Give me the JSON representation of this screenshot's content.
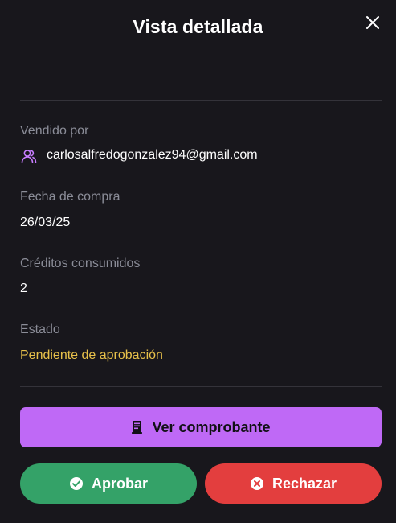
{
  "modal": {
    "title": "Vista detallada",
    "close_icon": "close-icon"
  },
  "details": {
    "seller": {
      "label": "Vendido por",
      "icon": "users-icon",
      "value": "carlosalfredogonzalez94@gmail.com"
    },
    "purchase_date": {
      "label": "Fecha de compra",
      "value": "26/03/25"
    },
    "credits": {
      "label": "Créditos consumidos",
      "value": "2"
    },
    "status": {
      "label": "Estado",
      "value": "Pendiente de aprobación",
      "color": "#e8c14a"
    }
  },
  "actions": {
    "voucher": {
      "label": "Ver comprobante",
      "icon": "receipt-icon",
      "color": "#bf69f6"
    },
    "approve": {
      "label": "Aprobar",
      "icon": "check-circle-icon",
      "color": "#34a268"
    },
    "reject": {
      "label": "Rechazar",
      "icon": "x-circle-icon",
      "color": "#e33e3e"
    }
  }
}
